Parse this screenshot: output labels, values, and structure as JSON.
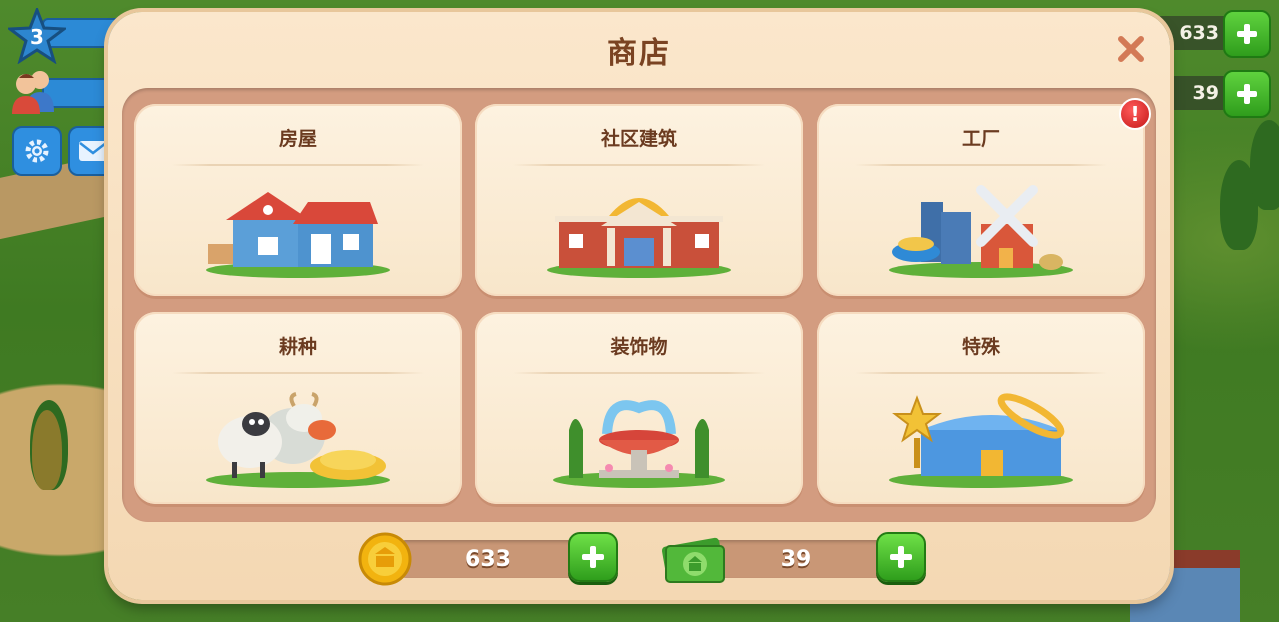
{
  "hud": {
    "level": "3",
    "coins_display": "633",
    "cash_display": "39"
  },
  "shop": {
    "title": "商店",
    "categories": [
      {
        "label": "房屋"
      },
      {
        "label": "社区建筑"
      },
      {
        "label": "工厂",
        "alert": "!"
      },
      {
        "label": "耕种"
      },
      {
        "label": "装饰物"
      },
      {
        "label": "特殊"
      }
    ],
    "coins": "633",
    "cash": "39"
  },
  "colors": {
    "dialog": "#f8e2c2",
    "panel": "#d39c80",
    "title": "#7a4322",
    "plus_green": "#3fb527",
    "alert_red": "#d62020"
  }
}
